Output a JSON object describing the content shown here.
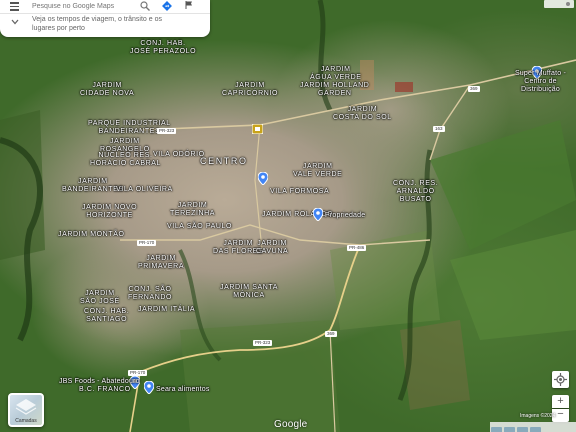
{
  "search": {
    "placeholder": "Pesquise no Google Maps",
    "hint": "Veja os tempos de viagem, o trânsito e os lugares por perto"
  },
  "icons": {
    "menu": "menu-icon",
    "search": "search-icon",
    "directions": "directions-icon",
    "chevron": "chevron-down-icon",
    "flag": "flag-icon",
    "location": "my-location-icon",
    "layers": "layers-icon",
    "marker": "map-pin-icon"
  },
  "map": {
    "labels": {
      "conj_hab_jose_perazolo": "CONJ. HAB.\nJOSÉ PERAZOLO",
      "jardim_cidade_nova": "JARDIM\nCIDADE NOVA",
      "jardim_capricornio": "JARDIM\nCAPRICÓRNIO",
      "jardim_agua_verde": "JARDIM\nÁGUA VERDE",
      "jardim_holland_garden": "JARDIM HOLLAND\nGARDEN",
      "jardim_costa_do_sol": "JARDIM\nCOSTA DO SOL",
      "parque_industrial": "PARQUE INDUSTRIAL\nBANDEIRANTES",
      "jardim_rosangelo": "JARDIM\nROSANGELO",
      "nucleo_res": "NÚCLEO RES.\nHORÁCIO CABRAL",
      "vila_odorio": "VILA ODÓRIO",
      "centro": "CENTRO",
      "jardim_vale_verde": "JARDIM\nVALE VERDE",
      "vila_formosa": "VILA FORMOSA",
      "jardim_bandeirantes": "JARDIM\nBANDEIRANTES",
      "vila_oliveira": "VILA OLIVEIRA",
      "conj_res_arnaldo_busato": "CONJ. RES.\nARNALDO\nBUSATO",
      "jardim_novo_horizonte": "JARDIM NOVO\nHORIZONTE",
      "jardim_terezinha": "JARDIM\nTEREZINHA",
      "jardim_rolando": "JARDIM ROLANDO",
      "jardim_montao": "JARDIM MONTÃO",
      "vila_sao_paulo": "VILA SÃO PAULO",
      "jardim_das_flores": "JARDIM\nDAS FLORES",
      "jardim_cavuna": "JARDIM\nCAVUNA",
      "jardim_primavera": "JARDIM\nPRIMAVERA",
      "conj_sao_fernando": "CONJ. SÃO\nFERNANDO",
      "jardim_santa_monica": "JARDIM SANTA\nMÔNICA",
      "jardim_sao_jose": "JARDIM\nSÃO JOSÉ",
      "conj_hab_santiago": "CONJ. HAB.\nSANTIAGO",
      "jardim_italia": "JARDIM ITÁLIA",
      "bc_franco": "B.C. FRANCO"
    },
    "poi": {
      "propriedade": "Propriedade",
      "super_muffato": "Super Muffato -\nCentro de Distribuição",
      "jbs": "JBS Foods - Abatedouro",
      "seara": "Seara alimentos"
    },
    "roads": {
      "pr_323": "PR-323",
      "r_163": "163",
      "pr_170": "PR-170",
      "pr_486": "PR-486",
      "pr_323b": "PR-323",
      "r_369": "369",
      "r_369b": "369",
      "pr_170b": "PR-170"
    }
  },
  "controls": {
    "layers_label": "Camadas",
    "zoom_in": "+",
    "zoom_out": "−",
    "google": "Google",
    "footer": "Imagens ©2024"
  }
}
